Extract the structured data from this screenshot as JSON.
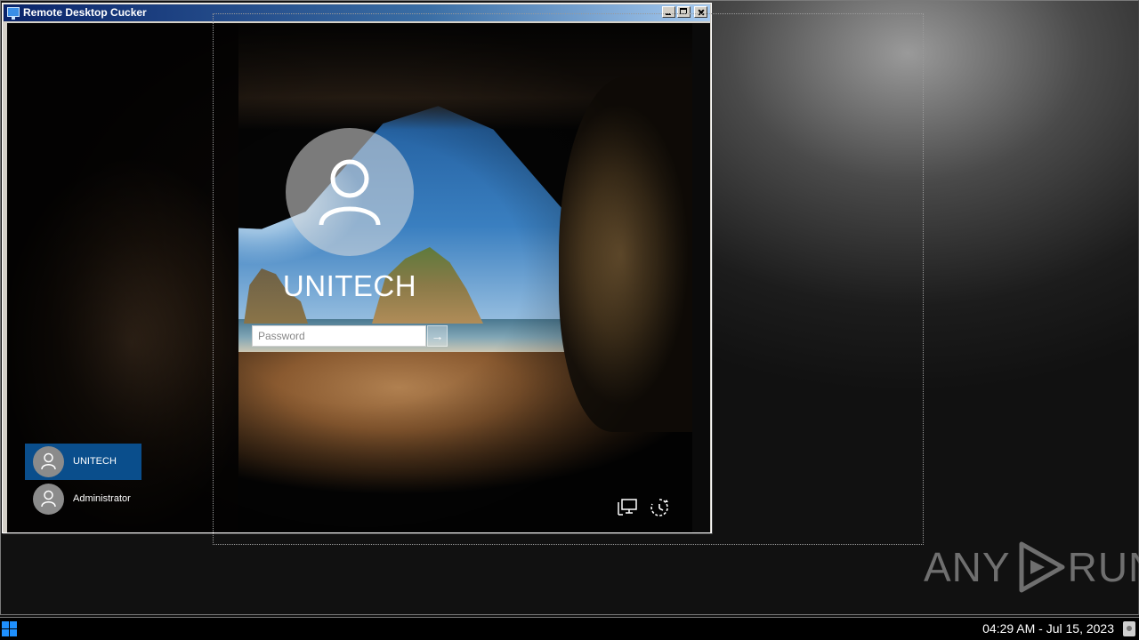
{
  "window": {
    "title": "Remote Desktop Cucker"
  },
  "login": {
    "username": "UNITECH",
    "password_placeholder": "Password",
    "submit_glyph": "→"
  },
  "user_list": [
    {
      "label": "UNITECH",
      "selected": true
    },
    {
      "label": "Administrator",
      "selected": false
    }
  ],
  "system_icons": [
    "network-icon",
    "ease-of-access-power-icon"
  ],
  "watermark": {
    "left": "ANY",
    "right": "RUN"
  },
  "taskbar": {
    "clock": "04:29 AM - Jul 15, 2023"
  },
  "colors": {
    "selected_user": "#0a4e8c",
    "titlebar": "#0a246a",
    "start_icon": "#1e90ff"
  }
}
